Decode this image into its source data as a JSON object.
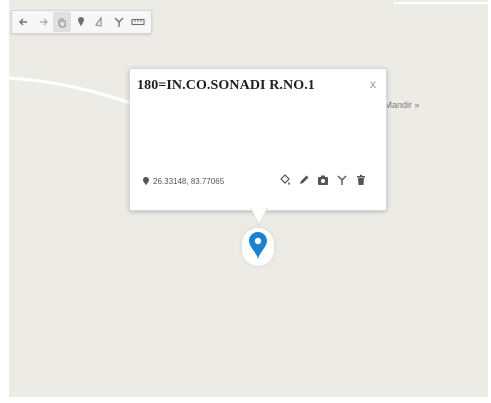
{
  "toolbar": {
    "tools": [
      "undo-icon",
      "redo-icon",
      "hand-icon",
      "marker-icon",
      "polygon-icon",
      "route-icon",
      "ruler-icon"
    ],
    "active": "hand-icon"
  },
  "map": {
    "place_label": "e Mandir »",
    "background_color": "#ecebe6",
    "road_color": "#ffffff"
  },
  "popup": {
    "title": "180=IN.CO.SONADI R.NO.1",
    "close_label": "x",
    "coordinates": "26.33148, 83.77065",
    "actions": [
      "paint-bucket-icon",
      "edit-pencil-icon",
      "camera-icon",
      "route-icon",
      "trash-icon"
    ]
  },
  "marker": {
    "color": "#1a82cf"
  }
}
